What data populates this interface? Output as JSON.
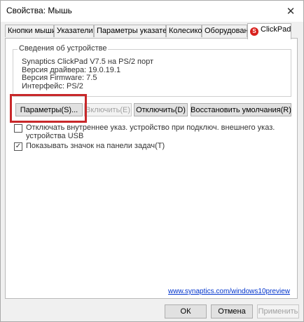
{
  "window": {
    "title": "Свойства: Мышь",
    "close_glyph": "✕"
  },
  "tabs": [
    {
      "label": "Кнопки мыши"
    },
    {
      "label": "Указатели"
    },
    {
      "label": "Параметры указателя"
    },
    {
      "label": "Колесико"
    },
    {
      "label": "Оборудование"
    },
    {
      "label": "ClickPad",
      "active": true
    }
  ],
  "device_info": {
    "group_title": "Сведения об устройстве",
    "lines": [
      "Synaptics ClickPad V7.5 на PS/2 порт",
      "Версия драйвера: 19.0.19.1",
      "Версия Firmware: 7.5",
      "Интерфейс: PS/2"
    ]
  },
  "buttons": {
    "params": "Параметры(S)...",
    "enable": "Включить(E)",
    "disable": "Отключить(D)",
    "restore": "Восстановить умолчания(R)"
  },
  "checkboxes": [
    {
      "label_line1": "Отключать внутреннее указ. устройство при подключ. внешнего указ.",
      "label_line2": "устройства USB",
      "checked": false
    },
    {
      "label_line1": "Показывать значок на панели задач(T)",
      "checked": true
    }
  ],
  "link": "www.synaptics.com/windows10preview",
  "footer": {
    "ok": "ОК",
    "cancel": "Отмена",
    "apply": "Применить"
  },
  "colors": {
    "highlight": "#c8282a",
    "link": "#0033cc"
  },
  "icons": {
    "clickpad_logo": "synaptics-logo-icon"
  }
}
